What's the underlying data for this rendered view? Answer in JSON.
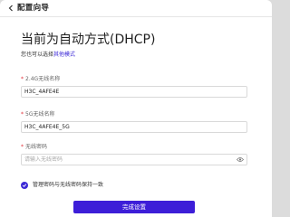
{
  "header": {
    "title": "配置向导",
    "back_icon": "chevron-left-icon"
  },
  "main": {
    "title": "当前为自动方式(DHCP)",
    "subtitle_prefix": "您也可以选择",
    "subtitle_link": "其他模式"
  },
  "fields": {
    "ssid_24": {
      "label": "2.4G无线名称",
      "value": "H3C_4AFE4E"
    },
    "ssid_5": {
      "label": "5G无线名称",
      "value": "H3C_4AFE4E_5G"
    },
    "password": {
      "label": "无线密码",
      "placeholder": "请输入无线密码",
      "icon": "eye-icon"
    }
  },
  "sync_option": {
    "label": "管理密码与无线密码保持一致",
    "checked": true
  },
  "actions": {
    "done_label": "完成设置"
  },
  "colors": {
    "accent": "#3d1ed8",
    "required": "#e0323a"
  }
}
